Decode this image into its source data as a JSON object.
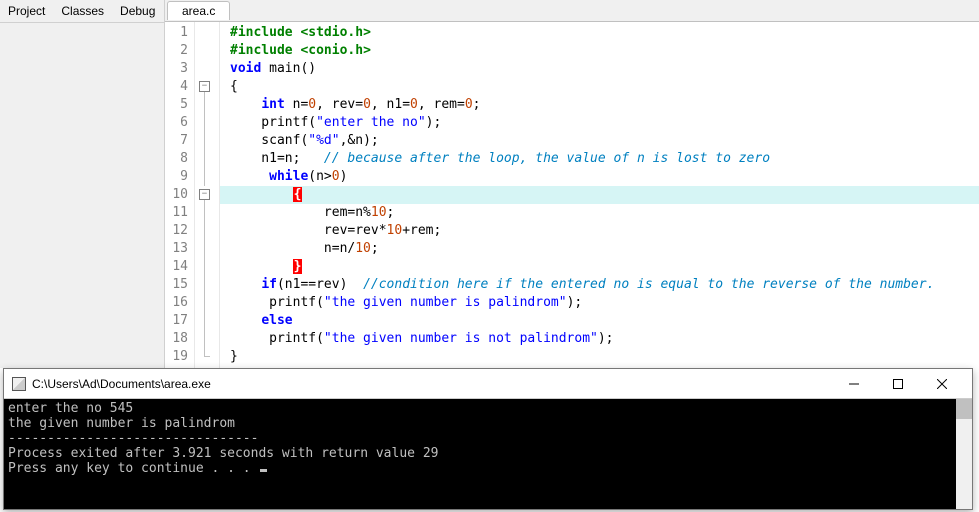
{
  "menubar": {
    "items": [
      "Project",
      "Classes",
      "Debug"
    ]
  },
  "tabs": {
    "active": "area.c"
  },
  "code": {
    "lines": [
      {
        "n": 1,
        "fold": "",
        "segs": [
          [
            "pp",
            "#include "
          ],
          [
            "pp",
            "<stdio.h>"
          ]
        ]
      },
      {
        "n": 2,
        "fold": "",
        "segs": [
          [
            "pp",
            "#include "
          ],
          [
            "pp",
            "<conio.h>"
          ]
        ]
      },
      {
        "n": 3,
        "fold": "",
        "segs": [
          [
            "kw",
            "void"
          ],
          [
            "",
            " "
          ],
          [
            "fn",
            "main"
          ],
          [
            "",
            "()"
          ]
        ]
      },
      {
        "n": 4,
        "fold": "box",
        "segs": [
          [
            "",
            "{"
          ]
        ]
      },
      {
        "n": 5,
        "fold": "v",
        "segs": [
          [
            "",
            "    "
          ],
          [
            "kw",
            "int"
          ],
          [
            "",
            " n="
          ],
          [
            "num",
            "0"
          ],
          [
            "",
            ", rev="
          ],
          [
            "num",
            "0"
          ],
          [
            "",
            ", n1="
          ],
          [
            "num",
            "0"
          ],
          [
            "",
            ", rem="
          ],
          [
            "num",
            "0"
          ],
          [
            "",
            ";"
          ]
        ]
      },
      {
        "n": 6,
        "fold": "v",
        "segs": [
          [
            "",
            "    printf("
          ],
          [
            "str",
            "\"enter the no\""
          ],
          [
            "",
            ");"
          ]
        ]
      },
      {
        "n": 7,
        "fold": "v",
        "segs": [
          [
            "",
            "    scanf("
          ],
          [
            "str",
            "\"%d\""
          ],
          [
            "",
            ",&n);"
          ]
        ]
      },
      {
        "n": 8,
        "fold": "v",
        "segs": [
          [
            "",
            "    n1=n;   "
          ],
          [
            "cmt",
            "// because after the loop, the value of n is lost to zero"
          ]
        ]
      },
      {
        "n": 9,
        "fold": "v",
        "segs": [
          [
            "",
            "     "
          ],
          [
            "kw",
            "while"
          ],
          [
            "",
            "(n>"
          ],
          [
            "num",
            "0"
          ],
          [
            "",
            ")"
          ]
        ]
      },
      {
        "n": 10,
        "fold": "box",
        "hl": true,
        "segs": [
          [
            "",
            "        "
          ],
          [
            "brace-match",
            "{"
          ]
        ]
      },
      {
        "n": 11,
        "fold": "v",
        "segs": [
          [
            "",
            "            rem=n%"
          ],
          [
            "num",
            "10"
          ],
          [
            "",
            ";"
          ]
        ]
      },
      {
        "n": 12,
        "fold": "v",
        "segs": [
          [
            "",
            "            rev=rev*"
          ],
          [
            "num",
            "10"
          ],
          [
            "",
            "+rem;"
          ]
        ]
      },
      {
        "n": 13,
        "fold": "v",
        "segs": [
          [
            "",
            "            n=n/"
          ],
          [
            "num",
            "10"
          ],
          [
            "",
            ";"
          ]
        ]
      },
      {
        "n": 14,
        "fold": "v",
        "segs": [
          [
            "",
            "        "
          ],
          [
            "brace-match",
            "}"
          ]
        ]
      },
      {
        "n": 15,
        "fold": "v",
        "segs": [
          [
            "",
            "    "
          ],
          [
            "kw",
            "if"
          ],
          [
            "",
            "(n1==rev)  "
          ],
          [
            "cmt",
            "//condition here if the entered no is equal to the reverse of the number."
          ]
        ]
      },
      {
        "n": 16,
        "fold": "v",
        "segs": [
          [
            "",
            "     printf("
          ],
          [
            "str",
            "\"the given number is palindrom\""
          ],
          [
            "",
            ");"
          ]
        ]
      },
      {
        "n": 17,
        "fold": "v",
        "segs": [
          [
            "",
            "    "
          ],
          [
            "kw",
            "else"
          ]
        ]
      },
      {
        "n": 18,
        "fold": "v",
        "segs": [
          [
            "",
            "     printf("
          ],
          [
            "str",
            "\"the given number is not palindrom\""
          ],
          [
            "",
            ");"
          ]
        ]
      },
      {
        "n": 19,
        "fold": "end",
        "segs": [
          [
            "",
            "}"
          ]
        ]
      }
    ]
  },
  "console": {
    "title": "C:\\Users\\Ad\\Documents\\area.exe",
    "lines": [
      "enter the no 545",
      "the given number is palindrom",
      "",
      "--------------------------------",
      "Process exited after 3.921 seconds with return value 29",
      "Press any key to continue . . . "
    ]
  }
}
